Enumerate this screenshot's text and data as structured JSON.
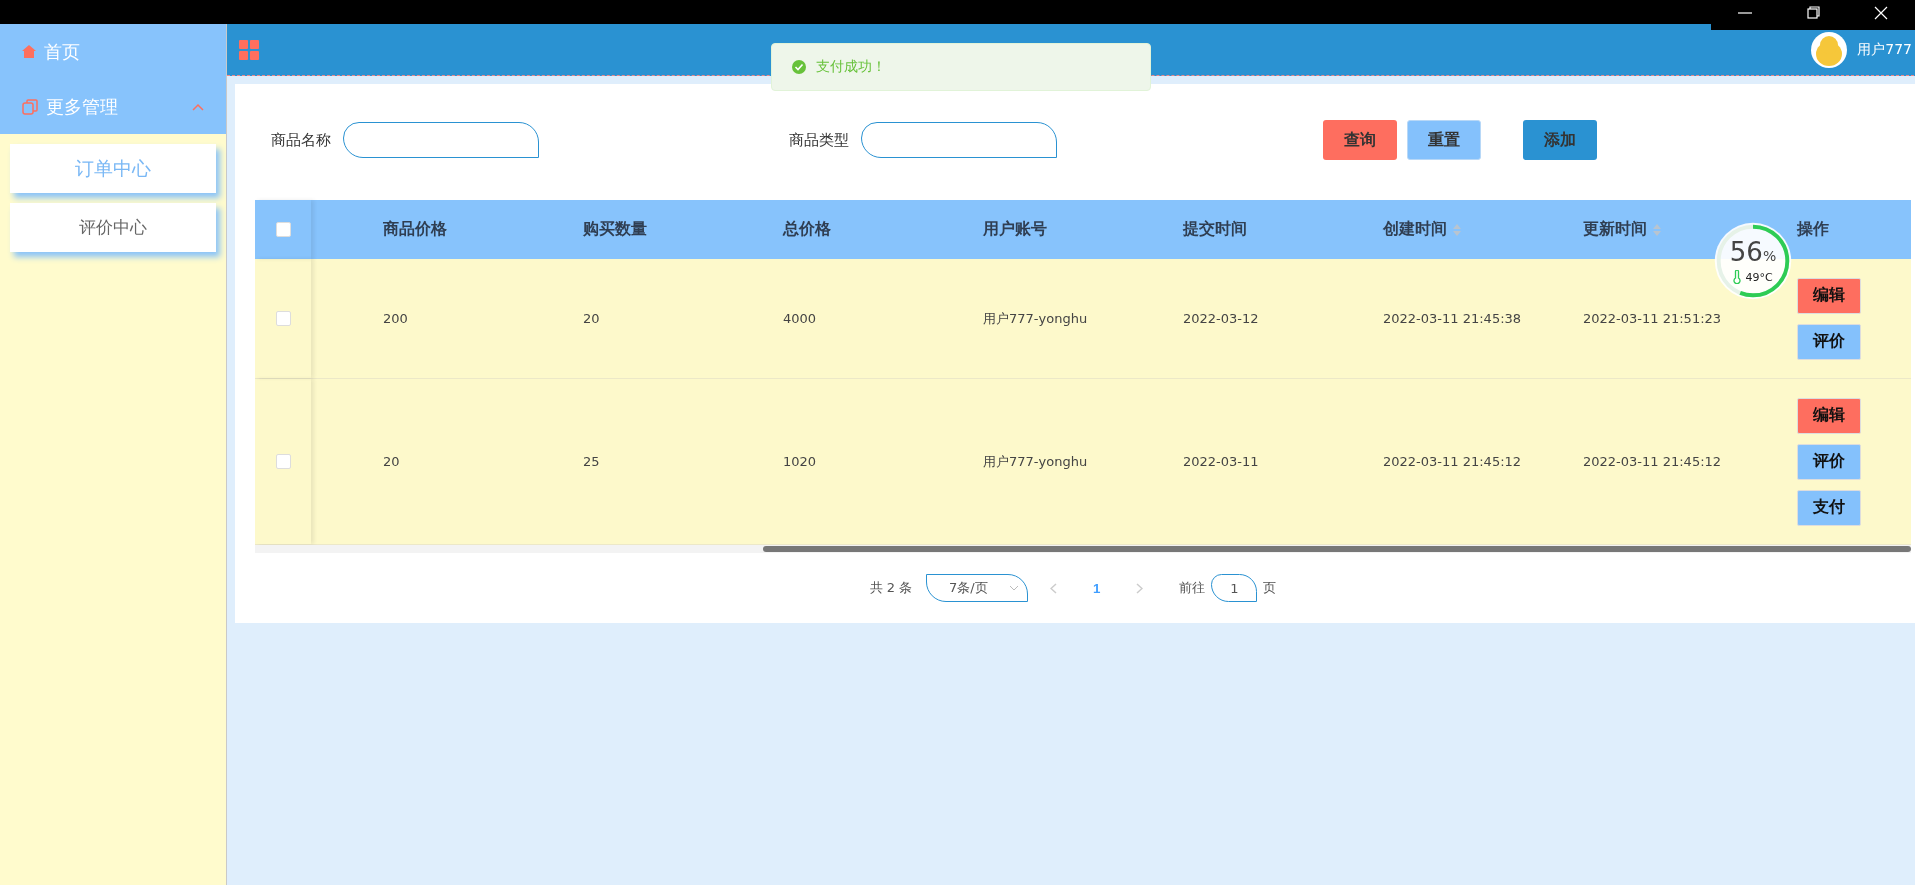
{
  "sidebar": {
    "items": [
      {
        "label": "首页",
        "kind": "link"
      },
      {
        "label": "更多管理",
        "kind": "group",
        "expanded": true,
        "children": [
          {
            "label": "订单中心",
            "selected": true
          },
          {
            "label": "评价中心",
            "selected": false
          }
        ]
      }
    ]
  },
  "header": {
    "user_name": "用户777"
  },
  "toast": {
    "message": "支付成功！"
  },
  "search": {
    "fields": [
      {
        "label": "商品名称"
      },
      {
        "label": "商品类型"
      }
    ],
    "buttons": [
      {
        "label": "查询",
        "kind": "danger"
      },
      {
        "label": "重置",
        "kind": "light"
      },
      {
        "label": "添加",
        "kind": "primary"
      }
    ]
  },
  "table": {
    "header_checked": false,
    "columns": [
      {
        "label": "商品价格",
        "sortable": false
      },
      {
        "label": "购买数量",
        "sortable": false
      },
      {
        "label": "总价格",
        "sortable": false
      },
      {
        "label": "用户账号",
        "sortable": false
      },
      {
        "label": "提交时间",
        "sortable": false
      },
      {
        "label": "创建时间",
        "sortable": true
      },
      {
        "label": "更新时间",
        "sortable": true
      },
      {
        "label": "操作",
        "sortable": false
      }
    ],
    "rows": [
      {
        "checked": false,
        "cells": [
          "200",
          "20",
          "4000",
          "用户777-yonghu",
          "2022-03-12",
          "2022-03-11 21:45:38",
          "2022-03-11 21:51:23"
        ],
        "actions": [
          {
            "label": "编辑",
            "kind": "danger"
          },
          {
            "label": "评价",
            "kind": "light"
          }
        ]
      },
      {
        "checked": false,
        "cells": [
          "20",
          "25",
          "1020",
          "用户777-yonghu",
          "2022-03-11",
          "2022-03-11 21:45:12",
          "2022-03-11 21:45:12"
        ],
        "actions": [
          {
            "label": "编辑",
            "kind": "danger"
          },
          {
            "label": "评价",
            "kind": "light"
          },
          {
            "label": "支付",
            "kind": "light"
          }
        ]
      }
    ]
  },
  "pagination": {
    "total": "共 2 条",
    "page_size": "7条/页",
    "pages": [
      {
        "label": "1",
        "selected": true
      }
    ],
    "goto_label": "前往",
    "goto_value": "1",
    "goto_suffix": "页"
  },
  "gauge": {
    "percent": "56",
    "unit": "%",
    "temperature": "49°C",
    "level": 0.56
  }
}
